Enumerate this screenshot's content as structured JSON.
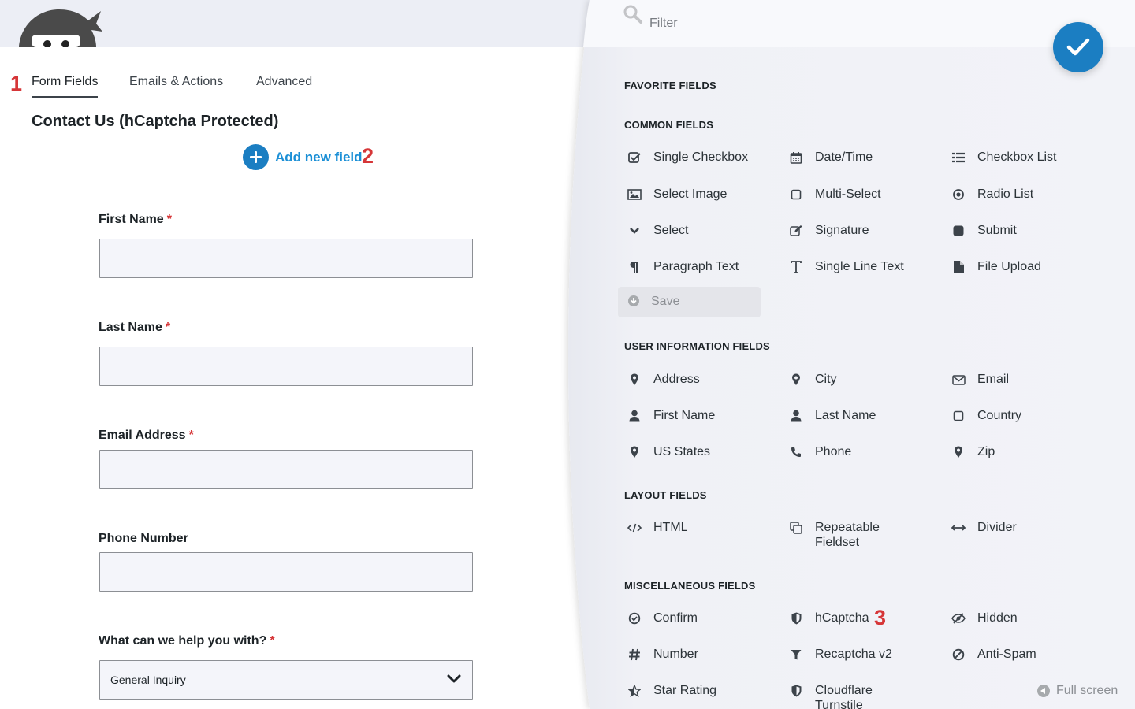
{
  "tabs": [
    {
      "label": "Form Fields"
    },
    {
      "label": "Emails & Actions"
    },
    {
      "label": "Advanced"
    }
  ],
  "annotations": {
    "one": "1",
    "two": "2",
    "three": "3"
  },
  "form": {
    "title": "Contact Us (hCaptcha Protected)",
    "add_field_label": "Add new field",
    "required_mark": "*",
    "fields": [
      {
        "label": "First Name",
        "value": ""
      },
      {
        "label": "Last Name",
        "value": ""
      },
      {
        "label": "Email Address",
        "value": ""
      },
      {
        "label": "Phone Number",
        "value": ""
      },
      {
        "label": "What can we help you with?",
        "value": "General Inquiry"
      }
    ]
  },
  "drawer": {
    "filter_placeholder": "Filter",
    "sections": {
      "favorite": "FAVORITE FIELDS",
      "common": "COMMON FIELDS",
      "user_info": "USER INFORMATION FIELDS",
      "layout": "LAYOUT FIELDS",
      "misc": "MISCELLANEOUS FIELDS"
    },
    "common": [
      {
        "label": "Single Checkbox",
        "icon": "check-square-icon"
      },
      {
        "label": "Date/Time",
        "icon": "calendar-icon"
      },
      {
        "label": "Checkbox List",
        "icon": "list-icon"
      },
      {
        "label": "Select Image",
        "icon": "image-icon"
      },
      {
        "label": "Multi-Select",
        "icon": "square-icon"
      },
      {
        "label": "Radio List",
        "icon": "dot-circle-icon"
      },
      {
        "label": "Select",
        "icon": "chevron-down-icon"
      },
      {
        "label": "Signature",
        "icon": "pencil-square-icon"
      },
      {
        "label": "Submit",
        "icon": "filled-square-icon"
      },
      {
        "label": "Paragraph Text",
        "icon": "paragraph-icon"
      },
      {
        "label": "Single Line Text",
        "icon": "text-cursor-icon"
      },
      {
        "label": "File Upload",
        "icon": "file-icon"
      }
    ],
    "save_label": "Save",
    "user_info": [
      {
        "label": "Address",
        "icon": "map-marker-icon"
      },
      {
        "label": "City",
        "icon": "map-marker-icon"
      },
      {
        "label": "Email",
        "icon": "envelope-icon"
      },
      {
        "label": "First Name",
        "icon": "user-icon"
      },
      {
        "label": "Last Name",
        "icon": "user-icon"
      },
      {
        "label": "Country",
        "icon": "square-icon"
      },
      {
        "label": "US States",
        "icon": "map-marker-icon"
      },
      {
        "label": "Phone",
        "icon": "phone-icon"
      },
      {
        "label": "Zip",
        "icon": "map-marker-icon"
      }
    ],
    "layout": [
      {
        "label": "HTML",
        "icon": "code-icon"
      },
      {
        "label_line1": "Repeatable",
        "label_line2": "Fieldset",
        "icon": "copy-icon"
      },
      {
        "label": "Divider",
        "icon": "arrows-h-icon"
      }
    ],
    "misc": [
      {
        "label": "Confirm",
        "icon": "check-circle-icon"
      },
      {
        "label": "hCaptcha",
        "icon": "shield-icon"
      },
      {
        "label": "Hidden",
        "icon": "eye-slash-icon"
      },
      {
        "label": "Number",
        "icon": "hashtag-icon"
      },
      {
        "label": "Recaptcha v2",
        "icon": "filter-icon"
      },
      {
        "label": "Anti-Spam",
        "icon": "ban-icon"
      },
      {
        "label": "Star Rating",
        "icon": "star-half-icon"
      },
      {
        "label_line1": "Cloudflare",
        "label_line2": "Turnstile",
        "icon": "shield-icon"
      }
    ],
    "fullscreen_label": "Full screen"
  },
  "colors": {
    "accent": "#1b7ec2",
    "link": "#1b8fd6",
    "required": "#d63638",
    "annotation": "#d63638"
  }
}
